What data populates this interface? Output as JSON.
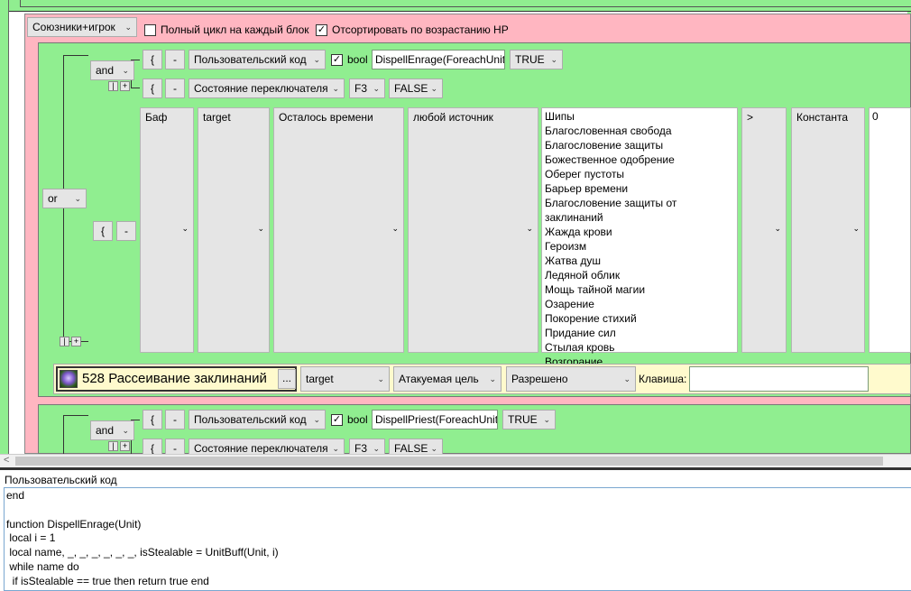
{
  "header": {
    "target_select": "Союзники+игрок",
    "full_cycle_label": "Полный цикл на каждый блок",
    "full_cycle_checked": false,
    "sort_label": "Отсортировать по возрастанию HP",
    "sort_checked": true
  },
  "block1": {
    "or_op": "or",
    "and_op": "and",
    "row1": {
      "brace": "{",
      "minus": "-",
      "type": "Пользовательский код",
      "bool_label": "bool",
      "code": "DispellEnrage(ForeachUnit)",
      "value": "TRUE"
    },
    "row2": {
      "brace": "{",
      "minus": "-",
      "type": "Состояние переключателя",
      "key": "F3",
      "value": "FALSE"
    },
    "row3": {
      "brace": "{",
      "minus": "-",
      "buff": "Баф",
      "target": "target",
      "time": "Осталось времени",
      "source": "любой источник",
      "compare": ">",
      "const": "Константа",
      "const_value": "0",
      "spells": [
        "Шипы",
        "Благословенная свобода",
        "Благословение защиты",
        "Божественное одобрение",
        "Оберег пустоты",
        "Барьер времени",
        "Благословение защиты от заклинаний",
        "Жажда крови",
        "Героизм",
        "Жатва душ",
        "Ледяной облик",
        "Мощь тайной магии",
        "Озарение",
        "Покорение стихий",
        "Придание сил",
        "Стылая кровь",
        "Возгорание"
      ]
    },
    "action": {
      "spell": "528 Рассеивание заклинаний",
      "dots": "...",
      "target": "target",
      "unit": "Атакуемая цель",
      "permission": "Разрешено",
      "key_label": "Клавиша:",
      "key_value": ""
    }
  },
  "block2": {
    "and_op": "and",
    "row1": {
      "brace": "{",
      "minus": "-",
      "type": "Пользовательский код",
      "bool_label": "bool",
      "code": "DispellPriest(ForeachUnit)",
      "value": "TRUE"
    },
    "row2": {
      "brace": "{",
      "minus": "-",
      "type": "Состояние переключателя",
      "key": "F3",
      "value": "FALSE"
    }
  },
  "code_panel": {
    "title": "Пользовательский код",
    "lines": [
      "end",
      "",
      "function DispellEnrage(Unit)",
      " local i = 1",
      " local name, _, _, _, _, _, _, isStealable = UnitBuff(Unit, i)",
      " while name do",
      "  if isStealable == true then return true end"
    ]
  },
  "colors": {
    "pink": "#ffb6c1",
    "green": "#90ee90",
    "action_bar": "#fffacd"
  }
}
